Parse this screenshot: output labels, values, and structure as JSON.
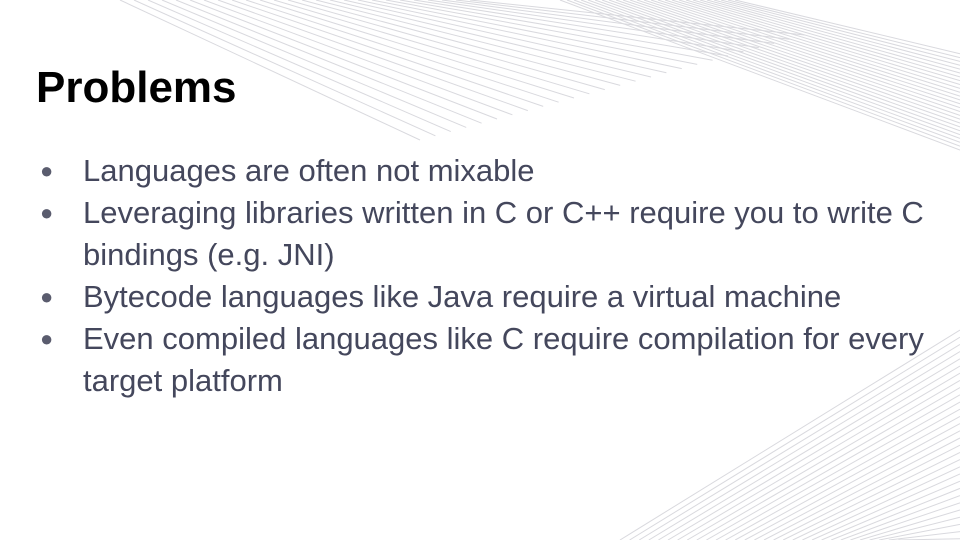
{
  "slide": {
    "title": "Problems",
    "bullet_glyph": "●",
    "bullets": [
      "Languages are often not mixable",
      "Leveraging libraries written in C or C++ require you to write C bindings (e.g. JNI)",
      "Bytecode languages like Java require a virtual machine",
      "Even compiled languages like C require compilation for every target platform"
    ]
  },
  "colors": {
    "background": "#ffffff",
    "title": "#000000",
    "body_text": "#44475c",
    "decor_lines": "#d9d9de"
  }
}
